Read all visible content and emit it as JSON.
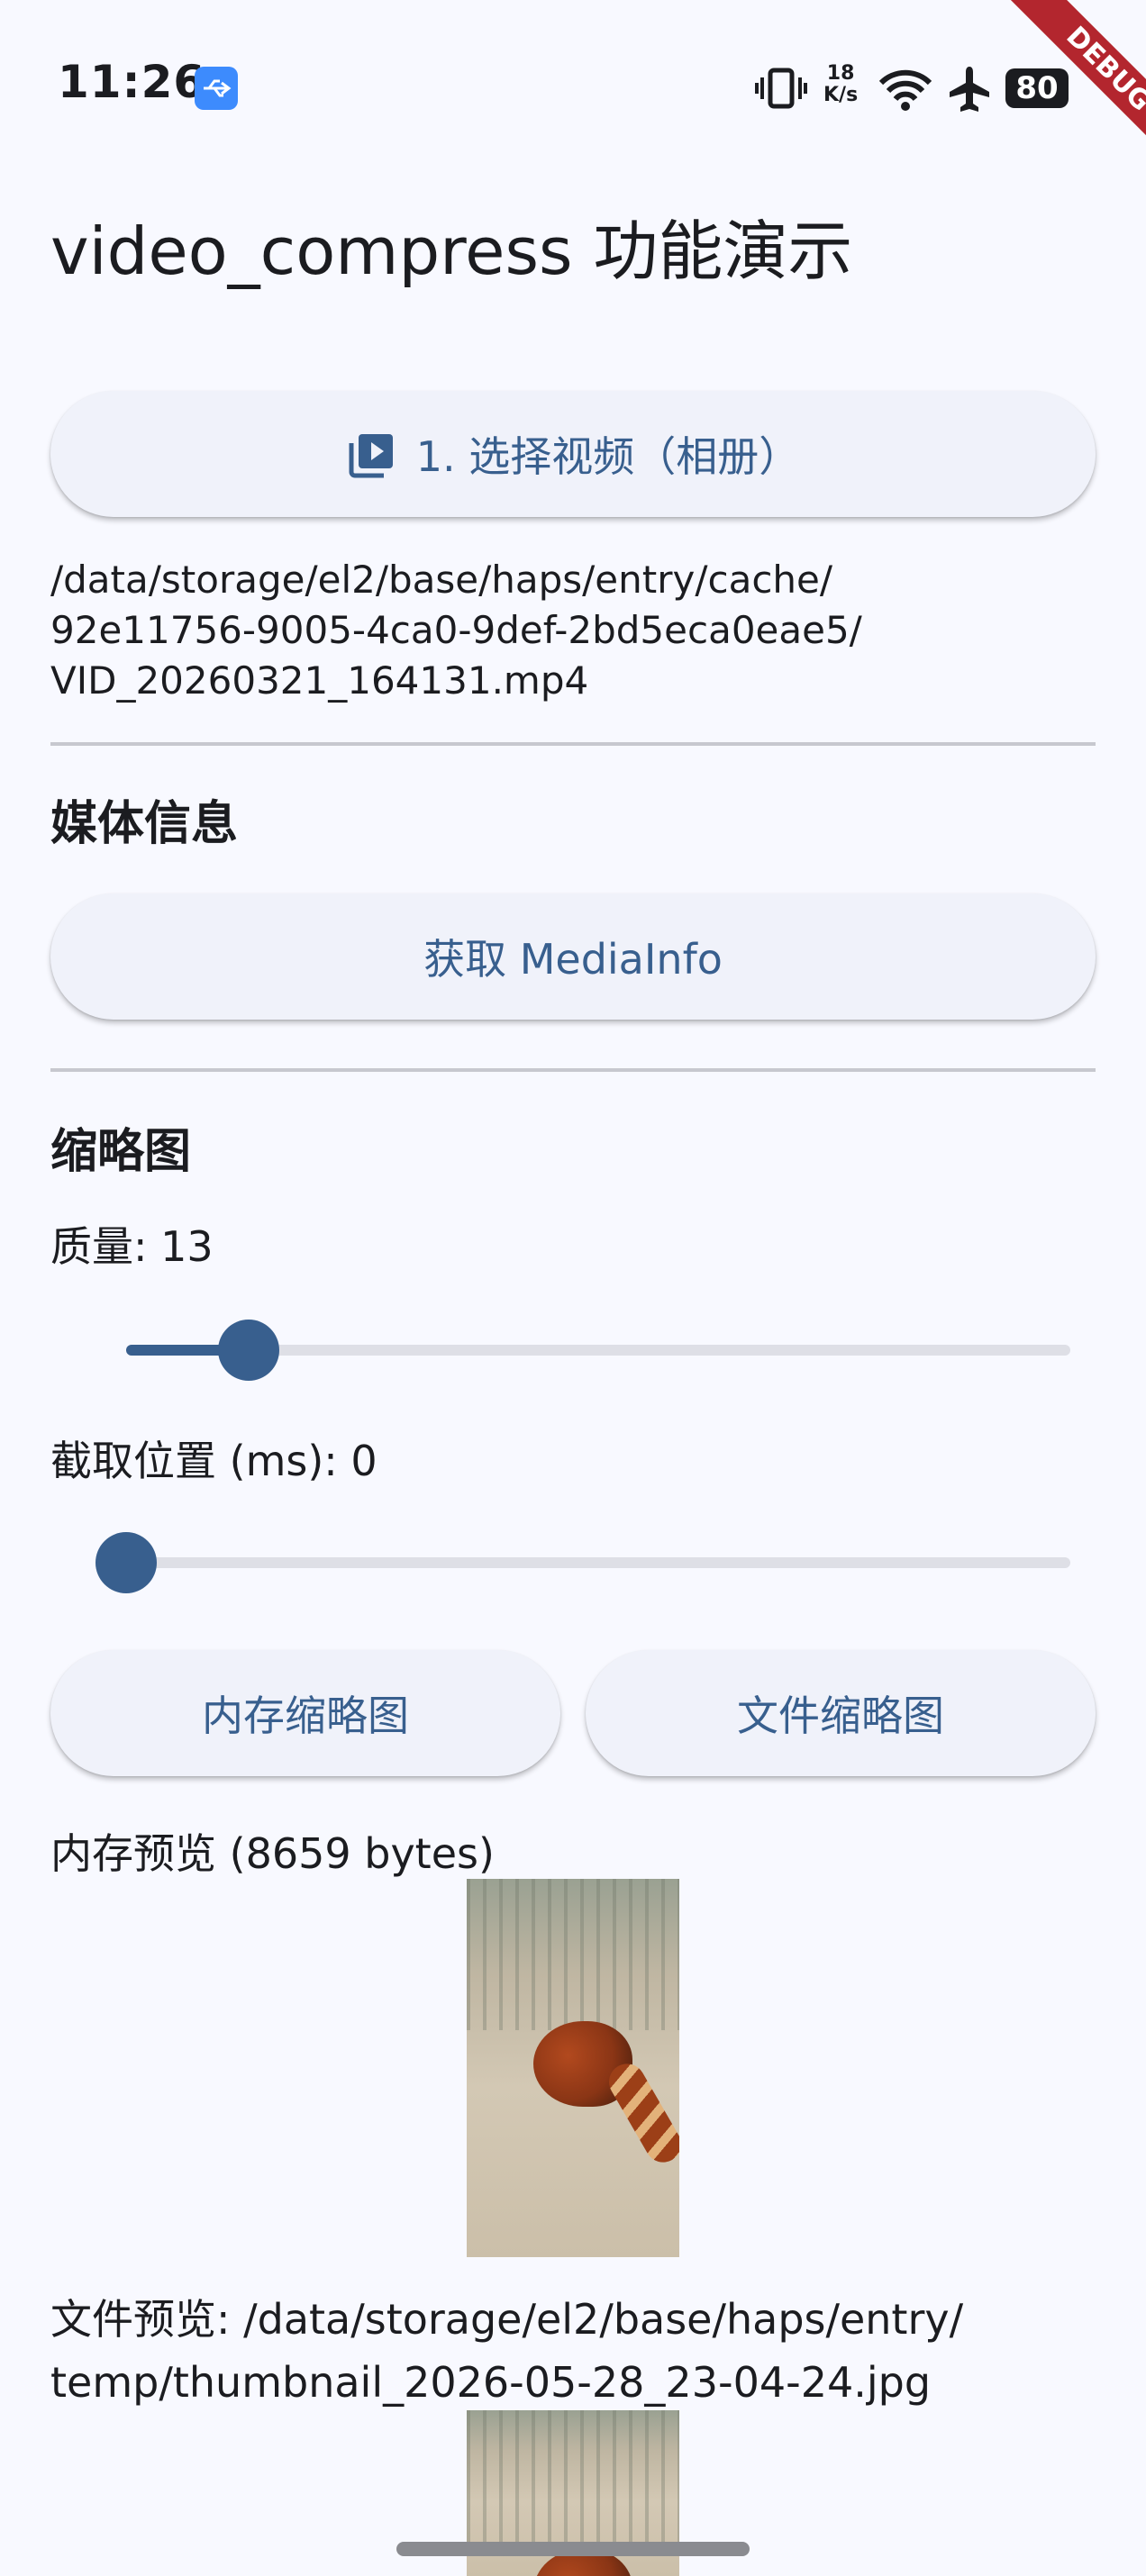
{
  "status_bar": {
    "time": "11:26",
    "net_speed_value": "18",
    "net_speed_unit": "K/s",
    "battery": "80",
    "debug_label": "DEBUG",
    "icons": [
      "usb-icon",
      "vibrate-icon",
      "wifi-icon",
      "airplane-icon",
      "battery-icon"
    ]
  },
  "app": {
    "title": "video_compress 功能演示"
  },
  "pick_video": {
    "button_label": "1. 选择视频（相册）",
    "icon": "video-library-icon",
    "selected_path": "/data/storage/el2/base/haps/entry/cache/\n92e11756-9005-4ca0-9def-2bd5eca0eae5/\nVID_20260321_164131.mp4"
  },
  "media_info": {
    "section_title": "媒体信息",
    "button_label": "获取 MediaInfo"
  },
  "thumbnail": {
    "section_title": "缩略图",
    "quality_label": "质量: 13",
    "quality_value": 13,
    "quality_range": [
      0,
      100
    ],
    "position_label": "截取位置 (ms): 0",
    "position_value": 0,
    "memory_button": "内存缩略图",
    "file_button": "文件缩略图",
    "memory_preview_label": "内存预览 (8659 bytes)",
    "file_preview_label": "文件预览: /data/storage/el2/base/haps/entry/\ntemp/thumbnail_2026-05-28_23-04-24.jpg"
  },
  "colors": {
    "primary": "#385f8e",
    "background": "#f8f9ff",
    "button_surface": "#f0f2fa",
    "divider": "#c7c8cf",
    "debug_ribbon": "#b3262e"
  }
}
